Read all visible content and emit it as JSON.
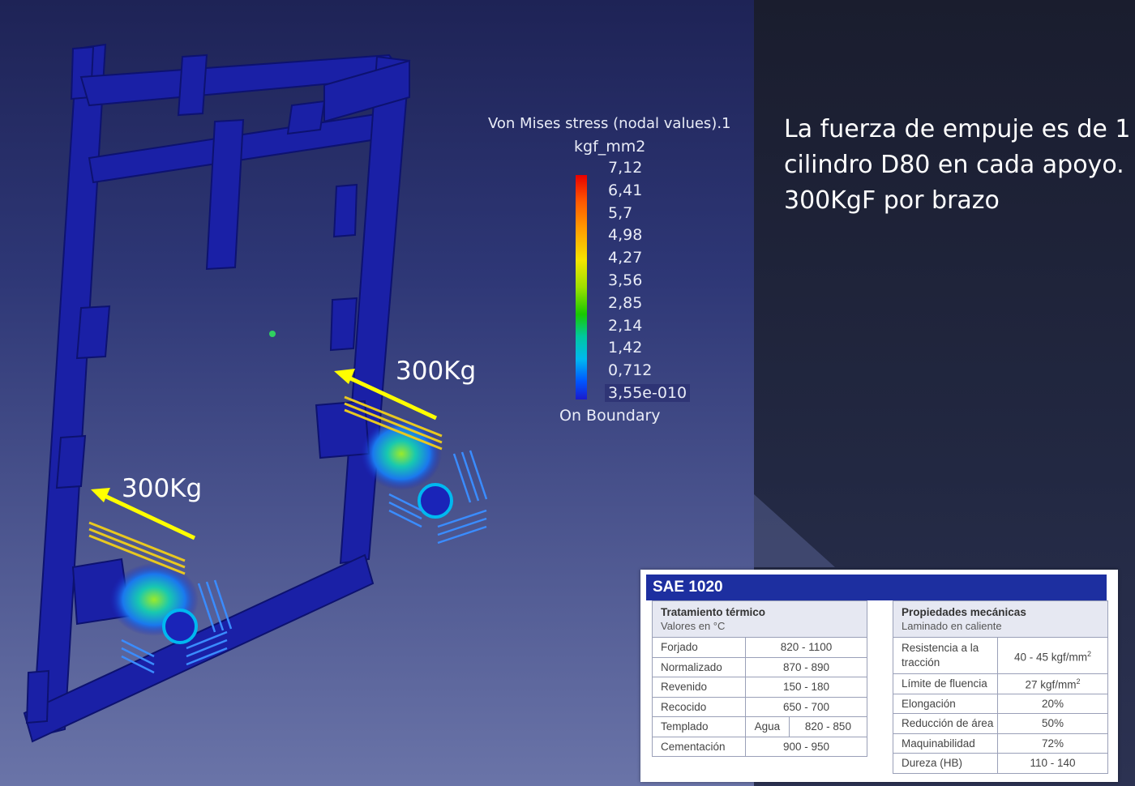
{
  "legend": {
    "title": "Von Mises stress (nodal values).1",
    "unit": "kgf_mm2",
    "values": [
      "7,12",
      "6,41",
      "5,7",
      "4,98",
      "4,27",
      "3,56",
      "2,85",
      "2,14",
      "1,42",
      "0,712",
      "3,55e-010"
    ],
    "footer": "On Boundary"
  },
  "loads": {
    "upper": "300Kg",
    "lower": "300Kg"
  },
  "description": {
    "line1": "La fuerza de empuje es de 1",
    "line2": "cilindro D80 en cada apoyo.",
    "line3": "300KgF por brazo"
  },
  "sae": {
    "title": "SAE 1020",
    "thermal": {
      "header": "Tratamiento térmico",
      "subheader": "Valores en °C",
      "rows": [
        {
          "name": "Forjado",
          "value": "820 - 1100"
        },
        {
          "name": "Normalizado",
          "value": "870 - 890"
        },
        {
          "name": "Revenido",
          "value": "150 - 180"
        },
        {
          "name": "Recocido",
          "value": "650 - 700"
        },
        {
          "name": "Templado",
          "medium": "Agua",
          "value": "820 - 850"
        },
        {
          "name": "Cementación",
          "value": "900 - 950"
        }
      ]
    },
    "mechanical": {
      "header": "Propiedades mecánicas",
      "subheader": "Laminado en caliente",
      "rows": [
        {
          "name": "Resistencia a la tracción",
          "value": "40 - 45 kgf/mm",
          "sup": "2"
        },
        {
          "name": "Límite de fluencia",
          "value": "27 kgf/mm",
          "sup": "2"
        },
        {
          "name": "Elongación",
          "value": "20%"
        },
        {
          "name": "Reducción de área",
          "value": "50%"
        },
        {
          "name": "Maquinabilidad",
          "value": "72%"
        },
        {
          "name": "Dureza (HB)",
          "value": "110 - 140"
        }
      ]
    }
  },
  "colors": {
    "background_left": "#3f4a8e",
    "background_right": "#1d2238",
    "frame_blue": "#1a22a8",
    "arrow_yellow": "#ffff00",
    "table_header": "#1d2fa0"
  }
}
